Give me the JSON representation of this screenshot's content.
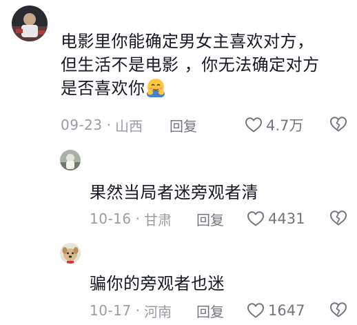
{
  "comments": [
    {
      "text_lines": [
        "电影里你能确定男女主喜欢对方，",
        "但生活不是电影 ，你无法确定对方",
        "是否喜欢你"
      ],
      "emoji": "hugging-face",
      "date": "09-23",
      "location": "山西",
      "reply_label": "回复",
      "likes": "4.7万"
    },
    {
      "text": "果然当局者迷旁观者清",
      "date": "10-16",
      "location": "甘肃",
      "reply_label": "回复",
      "likes": "4431"
    },
    {
      "text": "骗你的旁观者也迷",
      "date": "10-17",
      "location": "河南",
      "reply_label": "回复",
      "likes": "1647"
    }
  ],
  "colors": {
    "text": "#161823",
    "meta": "#9a9ca3",
    "icon": "#73757d"
  }
}
